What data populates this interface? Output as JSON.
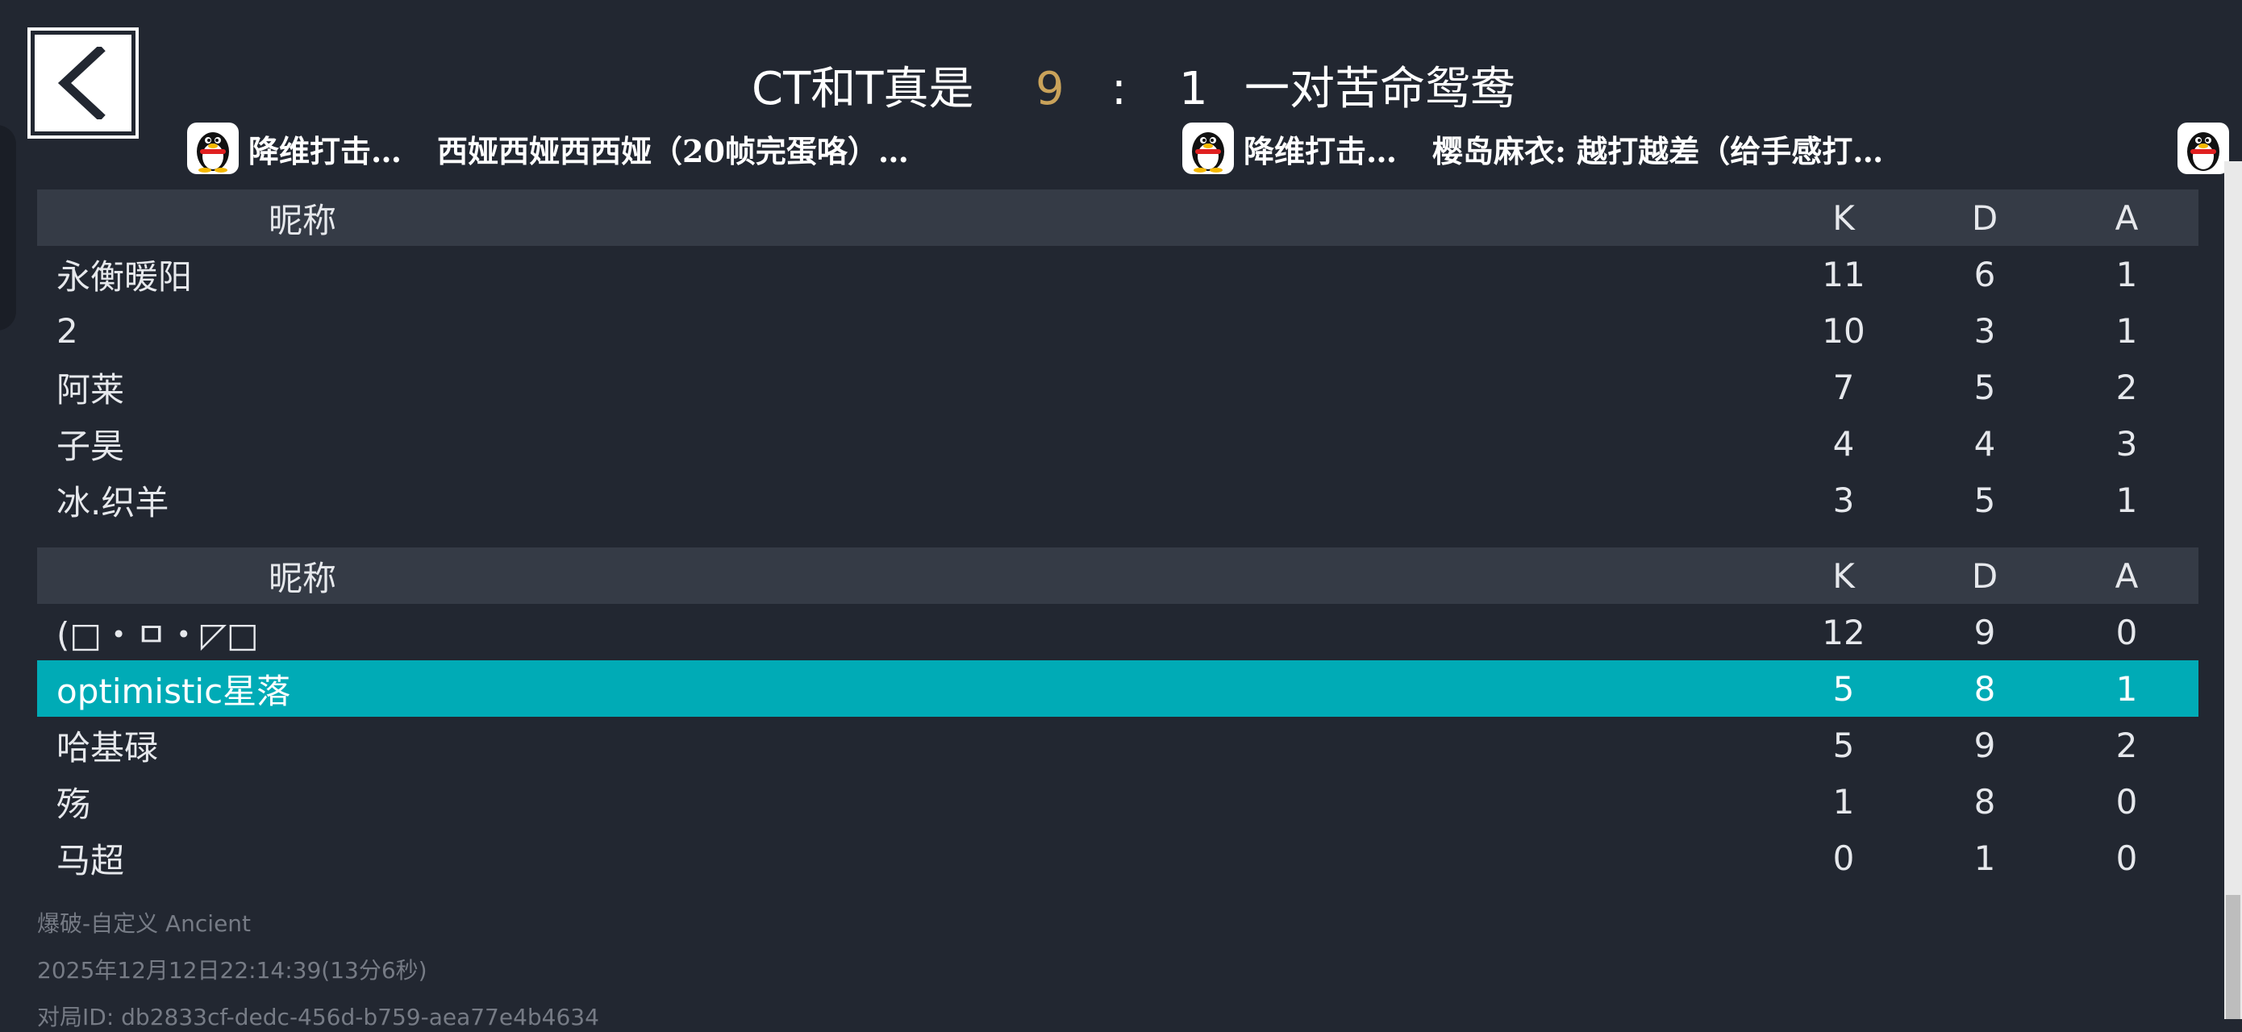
{
  "header": {
    "team_left": "CT和T真是",
    "score_left": "9",
    "score_sep": ":",
    "score_right": "1",
    "team_right": "一对苦命鸳鸯"
  },
  "barrage": [
    {
      "avatar_icon": "qq-penguin-icon",
      "name": "降维打击…",
      "text": "西娅西娅西西娅（20帧完蛋咯）…"
    },
    {
      "avatar_icon": "qq-penguin-icon",
      "name": "降维打击…",
      "text": "樱岛麻衣: 越打越差（给手感打…"
    }
  ],
  "team1": {
    "header": {
      "nick": "昵称",
      "k": "K",
      "d": "D",
      "a": "A"
    },
    "rows": [
      {
        "nick": "永衡暖阳",
        "k": "11",
        "d": "6",
        "a": "1"
      },
      {
        "nick": "2",
        "k": "10",
        "d": "3",
        "a": "1"
      },
      {
        "nick": "阿莱",
        "k": "7",
        "d": "5",
        "a": "2"
      },
      {
        "nick": "子昊",
        "k": "4",
        "d": "4",
        "a": "3"
      },
      {
        "nick": "冰.织羊",
        "k": "3",
        "d": "5",
        "a": "1"
      }
    ]
  },
  "team2": {
    "header": {
      "nick": "昵称",
      "k": "K",
      "d": "D",
      "a": "A"
    },
    "rows": [
      {
        "nick": "(□・ㅁ・◸□",
        "k": "12",
        "d": "9",
        "a": "0"
      },
      {
        "nick": "optimistic星落",
        "k": "5",
        "d": "8",
        "a": "1",
        "highlight": true
      },
      {
        "nick": "哈基碌",
        "k": "5",
        "d": "9",
        "a": "2"
      },
      {
        "nick": "殇",
        "k": "1",
        "d": "8",
        "a": "0"
      },
      {
        "nick": "马超",
        "k": "0",
        "d": "1",
        "a": "0"
      }
    ]
  },
  "meta": {
    "mode": "爆破-自定义 Ancient",
    "time": "2025年12月12日22:14:39(13分6秒)",
    "match_id": "对局ID: db2833cf-dedc-456d-b759-aea77e4b4634"
  },
  "colors": {
    "background": "#222731",
    "header_row": "#353b46",
    "highlight_row": "#00abb6",
    "score_accent": "#c9a25a"
  }
}
